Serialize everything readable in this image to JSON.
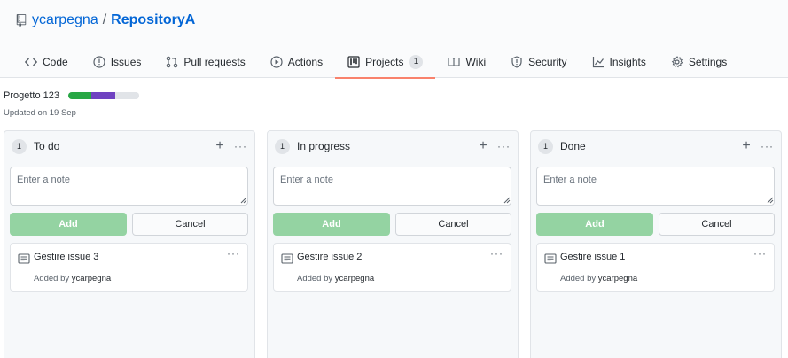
{
  "repo": {
    "owner": "ycarpegna",
    "separator": "/",
    "name": "RepositoryA",
    "icon": "repo-icon"
  },
  "tabs": [
    {
      "label": "Code",
      "icon": "code-icon"
    },
    {
      "label": "Issues",
      "icon": "issue-opened-icon"
    },
    {
      "label": "Pull requests",
      "icon": "git-pull-request-icon"
    },
    {
      "label": "Actions",
      "icon": "play-icon"
    },
    {
      "label": "Projects",
      "icon": "project-icon",
      "counter": "1",
      "selected": true
    },
    {
      "label": "Wiki",
      "icon": "book-icon"
    },
    {
      "label": "Security",
      "icon": "shield-icon"
    },
    {
      "label": "Insights",
      "icon": "graph-icon"
    },
    {
      "label": "Settings",
      "icon": "gear-icon"
    }
  ],
  "project": {
    "name": "Progetto 123",
    "updated": "Updated on 19 Sep",
    "progress": {
      "done": 0.33,
      "in_progress": 0.33,
      "todo": 0.34
    },
    "colors": {
      "done": "#28a745",
      "in_progress": "#6f42c1",
      "todo": "#e1e4e8"
    }
  },
  "columns": [
    {
      "count": "1",
      "title": "To do",
      "note_placeholder": "Enter a note",
      "add_label": "Add",
      "cancel_label": "Cancel",
      "card": {
        "title": "Gestire issue 3",
        "added_by_prefix": "Added by",
        "added_by_user": "ycarpegna",
        "icon": "note-icon"
      }
    },
    {
      "count": "1",
      "title": "In progress",
      "note_placeholder": "Enter a note",
      "add_label": "Add",
      "cancel_label": "Cancel",
      "card": {
        "title": "Gestire issue 2",
        "added_by_prefix": "Added by",
        "added_by_user": "ycarpegna",
        "icon": "note-icon"
      }
    },
    {
      "count": "1",
      "title": "Done",
      "note_placeholder": "Enter a note",
      "add_label": "Add",
      "cancel_label": "Cancel",
      "card": {
        "title": "Gestire issue 1",
        "added_by_prefix": "Added by",
        "added_by_user": "ycarpegna",
        "icon": "note-icon"
      }
    }
  ],
  "colors": {
    "link": "#0366d6",
    "selected_tab_underline": "#f9826c",
    "add_button": "#94d3a2"
  }
}
